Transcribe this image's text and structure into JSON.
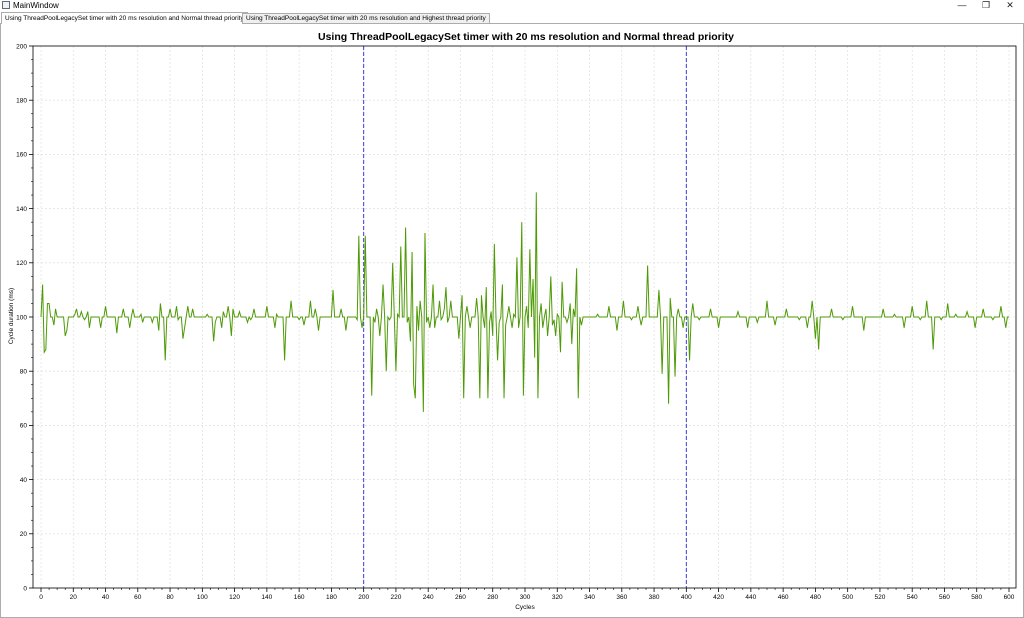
{
  "window": {
    "title": "MainWindow",
    "controls": {
      "minimize": "—",
      "restore": "❐",
      "close": "✕"
    }
  },
  "tabs": [
    {
      "label": "Using ThreadPoolLegacySet timer with 20 ms resolution and Normal thread priority",
      "active": true
    },
    {
      "label": "Using ThreadPoolLegacySet timer with 20 ms resolution and Highest thread priority",
      "active": false
    }
  ],
  "chart_data": {
    "type": "line",
    "title": "Using ThreadPoolLegacySet timer with 20 ms resolution and Normal thread priority",
    "xlabel": "Cycles",
    "ylabel": "Cycle duration (ms)",
    "xlim": [
      0,
      600
    ],
    "ylim": [
      0,
      200
    ],
    "xticks": [
      0,
      20,
      40,
      60,
      80,
      100,
      120,
      140,
      160,
      180,
      200,
      220,
      240,
      260,
      280,
      300,
      320,
      340,
      360,
      380,
      400,
      420,
      440,
      460,
      480,
      500,
      520,
      540,
      560,
      580,
      600
    ],
    "yticks": [
      0,
      20,
      40,
      60,
      80,
      100,
      120,
      140,
      160,
      180,
      200
    ],
    "grid": true,
    "vertical_markers": [
      200,
      400
    ],
    "colors": {
      "series": "#4e9a06",
      "markers": "#3b3bd6",
      "grid": "#d9d9d9"
    },
    "series": [
      {
        "values": [
          100,
          112,
          87,
          100,
          105,
          94,
          100,
          100,
          100,
          103,
          100,
          100,
          100,
          100,
          100,
          93,
          100,
          100,
          100,
          100,
          100,
          101,
          100,
          100,
          100,
          102,
          100,
          100,
          100,
          102,
          100,
          100,
          100,
          98,
          100,
          100,
          100,
          96,
          100,
          100,
          104,
          100,
          100,
          100,
          100,
          100,
          100,
          92,
          100,
          100,
          100,
          103,
          100,
          100,
          100,
          100,
          100,
          103,
          100,
          100,
          100,
          100,
          101,
          100,
          100,
          100,
          100,
          100,
          100,
          98,
          100,
          100,
          100,
          95,
          100,
          100,
          100,
          100,
          100,
          100,
          103,
          100,
          100,
          100,
          100,
          99,
          100,
          100,
          100,
          96,
          100,
          104,
          100,
          100,
          100,
          100,
          100,
          100,
          100,
          100,
          100,
          100,
          100,
          101,
          100,
          100,
          100,
          91,
          100,
          100,
          100,
          100,
          98,
          102,
          100,
          100,
          100,
          100,
          95,
          103,
          100,
          100,
          100,
          100,
          100,
          100,
          100,
          100,
          98,
          100,
          100,
          100,
          103,
          100,
          100,
          100,
          100,
          100,
          100,
          100,
          100,
          100,
          100,
          100,
          100,
          100,
          101,
          100,
          100,
          100,
          100,
          84,
          100,
          100,
          100,
          100,
          100,
          100,
          100,
          100,
          100,
          100,
          100,
          97,
          100,
          100,
          100,
          106,
          100,
          100,
          100,
          100,
          100,
          100,
          100,
          100,
          100,
          100,
          100,
          100,
          100,
          100,
          100,
          100,
          100,
          100,
          100,
          100,
          100,
          100,
          100,
          100,
          100,
          100,
          100,
          100,
          100,
          130,
          100,
          100,
          100,
          100,
          100,
          100,
          100,
          100,
          100,
          100,
          100,
          100,
          100,
          100,
          100,
          100,
          100,
          100,
          100,
          100,
          100,
          100,
          100,
          100,
          100,
          100,
          100,
          100,
          100,
          100,
          100,
          100,
          100,
          100,
          100,
          100,
          100,
          100,
          100,
          100,
          100,
          100,
          100,
          100,
          100,
          100,
          100,
          100,
          100,
          100,
          100,
          100,
          100,
          100,
          100,
          100,
          100,
          100,
          100,
          100,
          100,
          100,
          100,
          100,
          100,
          100,
          100,
          100,
          100,
          100,
          100,
          100,
          100,
          100,
          100,
          100,
          100,
          100,
          100,
          100,
          100,
          100,
          100,
          100,
          100,
          100,
          100,
          100,
          100,
          100,
          100,
          100,
          100,
          100,
          100,
          100,
          100,
          100,
          100,
          100,
          100,
          100,
          100,
          100,
          100,
          100,
          100,
          100,
          100,
          100,
          100,
          100,
          100,
          100,
          100,
          100,
          100,
          100,
          100,
          100,
          100,
          100,
          100,
          100,
          100,
          100,
          100,
          100,
          100,
          100,
          100,
          100,
          100,
          100,
          100,
          100,
          100,
          100,
          100,
          100,
          100,
          100,
          100,
          100,
          100,
          100,
          100,
          100,
          100,
          100,
          100,
          100,
          100,
          100,
          100,
          100,
          100,
          100,
          100,
          100,
          100,
          100,
          100,
          100,
          100,
          100,
          100,
          100,
          100,
          100,
          100,
          100,
          100,
          100,
          100,
          100,
          100,
          100,
          100,
          100,
          100,
          100,
          100,
          100,
          100,
          100,
          100,
          100,
          100,
          100,
          100,
          100,
          100,
          100,
          100,
          100,
          100,
          100,
          100,
          100,
          100,
          100,
          100,
          100,
          100,
          100,
          100,
          100,
          100,
          100,
          100,
          100,
          100,
          100,
          100,
          100,
          100,
          100,
          100,
          100,
          100,
          100,
          100,
          100,
          100,
          100,
          100,
          100,
          100,
          100,
          100,
          100,
          100,
          100,
          100,
          100,
          100,
          100,
          100,
          100,
          100,
          100,
          100,
          100,
          100,
          100,
          100,
          100,
          100,
          100,
          100,
          100,
          100,
          100,
          100,
          100,
          100,
          100,
          100,
          100,
          100,
          100,
          100,
          100,
          100,
          100,
          100,
          100,
          100,
          100,
          100,
          100,
          100,
          100,
          100,
          100,
          100,
          100,
          100,
          100,
          100,
          100,
          100,
          100,
          100,
          100,
          100,
          100,
          100,
          100,
          100,
          100,
          100,
          100,
          100,
          100,
          100,
          100,
          100,
          100,
          100,
          100,
          100,
          100,
          100,
          100,
          100,
          100,
          100,
          100,
          100,
          100,
          100,
          100,
          100,
          100,
          100,
          100,
          100,
          100,
          100,
          100,
          100,
          100,
          100,
          100,
          100,
          100,
          100,
          100,
          100,
          100,
          100,
          100,
          100,
          100,
          100,
          100,
          100,
          100,
          100,
          100,
          100,
          100,
          100,
          100,
          100,
          100,
          100,
          100,
          100,
          100,
          100,
          100,
          100,
          100,
          100,
          100,
          100,
          100,
          100,
          100,
          100,
          100,
          100,
          100,
          100,
          100,
          100,
          100,
          100,
          100,
          100,
          100,
          100,
          100,
          100,
          100,
          100,
          100,
          100,
          100,
          100,
          100,
          100,
          100,
          100,
          100,
          100,
          100,
          100,
          100,
          100,
          100,
          100,
          100,
          100,
          100,
          100,
          100,
          100,
          100,
          100,
          100,
          100,
          100,
          100,
          100,
          100,
          100,
          100
        ]
      }
    ],
    "spikes": [
      [
        205,
        71
      ],
      [
        207,
        98
      ],
      [
        208,
        103
      ],
      [
        210,
        93
      ],
      [
        212,
        112
      ],
      [
        214,
        80
      ],
      [
        216,
        99
      ],
      [
        218,
        120
      ],
      [
        220,
        80
      ],
      [
        221,
        101
      ],
      [
        223,
        126
      ],
      [
        225,
        100
      ],
      [
        226,
        133
      ],
      [
        227,
        98
      ],
      [
        229,
        91
      ],
      [
        230,
        124
      ],
      [
        231,
        75
      ],
      [
        232,
        70
      ],
      [
        233,
        104
      ],
      [
        234,
        95
      ],
      [
        235,
        106
      ],
      [
        237,
        65
      ],
      [
        238,
        131
      ],
      [
        239,
        98
      ],
      [
        241,
        96
      ],
      [
        243,
        112
      ],
      [
        244,
        96
      ],
      [
        245,
        100
      ],
      [
        247,
        106
      ],
      [
        248,
        99
      ],
      [
        250,
        103
      ],
      [
        251,
        111
      ],
      [
        252,
        98
      ],
      [
        254,
        106
      ],
      [
        255,
        100
      ],
      [
        257,
        100
      ],
      [
        259,
        92
      ],
      [
        261,
        108
      ],
      [
        262,
        70
      ],
      [
        264,
        104
      ],
      [
        266,
        96
      ],
      [
        268,
        100
      ],
      [
        270,
        107
      ],
      [
        272,
        70
      ],
      [
        273,
        108
      ],
      [
        275,
        96
      ],
      [
        276,
        111
      ],
      [
        277,
        70
      ],
      [
        278,
        98
      ],
      [
        279,
        102
      ],
      [
        280,
        93
      ],
      [
        281,
        127
      ],
      [
        283,
        84
      ],
      [
        284,
        98
      ],
      [
        286,
        112
      ],
      [
        287,
        70
      ],
      [
        288,
        97
      ],
      [
        290,
        104
      ],
      [
        292,
        96
      ],
      [
        293,
        101
      ],
      [
        295,
        122
      ],
      [
        296,
        96
      ],
      [
        298,
        135
      ],
      [
        299,
        71
      ],
      [
        300,
        100
      ],
      [
        301,
        104
      ],
      [
        302,
        96
      ],
      [
        303,
        125
      ],
      [
        305,
        114
      ],
      [
        306,
        85
      ],
      [
        307,
        146
      ],
      [
        308,
        70
      ],
      [
        310,
        105
      ],
      [
        311,
        96
      ],
      [
        313,
        103
      ],
      [
        314,
        93
      ],
      [
        316,
        115
      ],
      [
        317,
        97
      ],
      [
        318,
        99
      ],
      [
        319,
        93
      ],
      [
        320,
        101
      ],
      [
        322,
        87
      ],
      [
        323,
        113
      ],
      [
        325,
        100
      ],
      [
        326,
        98
      ],
      [
        328,
        105
      ],
      [
        329,
        90
      ],
      [
        330,
        103
      ],
      [
        332,
        118
      ],
      [
        333,
        70
      ],
      [
        335,
        97
      ],
      [
        337,
        100
      ],
      [
        339,
        100
      ]
    ]
  }
}
